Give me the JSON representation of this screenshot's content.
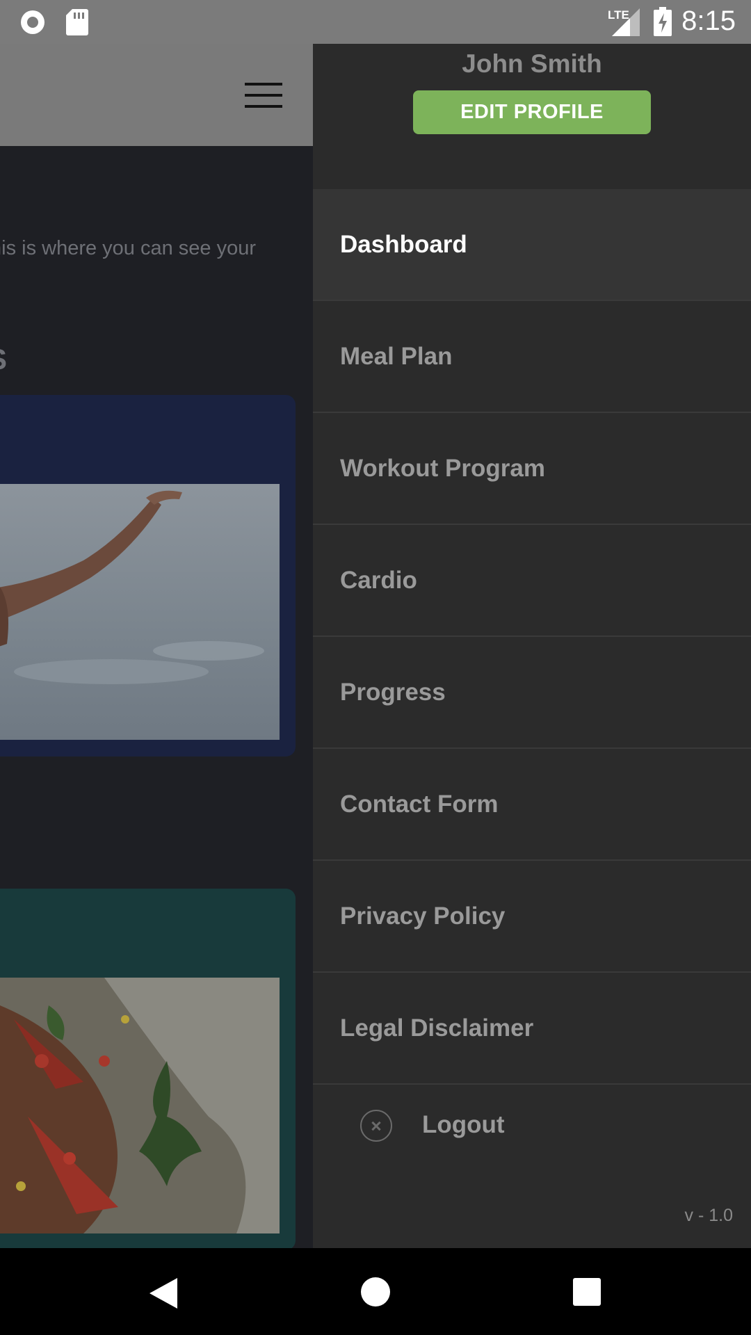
{
  "status_bar": {
    "time": "8:15",
    "network": "LTE",
    "icons": [
      "record-icon",
      "sd-card-icon",
      "lte-signal-icon",
      "battery-charging-icon"
    ]
  },
  "app": {
    "intro_text": "nis is where you can see your",
    "section_glyph": "S"
  },
  "drawer": {
    "user_name": "John Smith",
    "edit_profile_label": "EDIT PROFILE",
    "menu": [
      {
        "label": "Dashboard",
        "active": true
      },
      {
        "label": "Meal Plan",
        "active": false
      },
      {
        "label": "Workout Program",
        "active": false
      },
      {
        "label": "Cardio",
        "active": false
      },
      {
        "label": "Progress",
        "active": false
      },
      {
        "label": "Contact Form",
        "active": false
      },
      {
        "label": "Privacy Policy",
        "active": false
      },
      {
        "label": "Legal Disclaimer",
        "active": false
      }
    ],
    "logout_label": "Logout",
    "version": "v - 1.0"
  },
  "colors": {
    "accent_green": "#7db35a",
    "drawer_bg": "#2b2b2b",
    "active_item_bg": "#353535"
  }
}
